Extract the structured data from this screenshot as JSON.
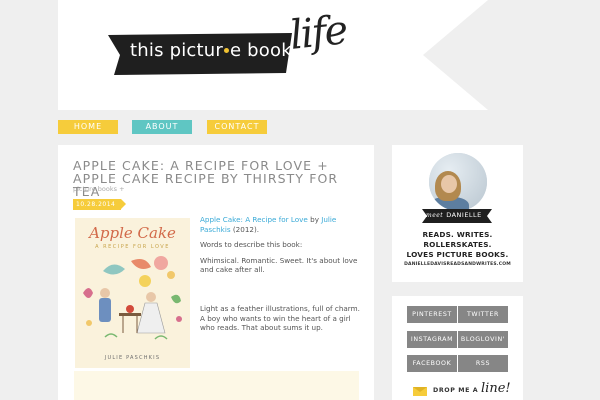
{
  "header": {
    "logo_text_1": "this pictur",
    "logo_text_2": "e book",
    "logo_script": "life"
  },
  "nav": {
    "home": "HOME",
    "about": "ABOUT",
    "contact": "CONTACT"
  },
  "post": {
    "title": "APPLE CAKE: A RECIPE FOR LOVE + APPLE CAKE RECIPE BY THIRSTY FOR TEA",
    "category": "picture books +",
    "date": "10.28.2014",
    "book": {
      "title": "Apple Cake",
      "subtitle": "A RECIPE FOR LOVE",
      "author": "JULIE PASCHKIS"
    },
    "body": {
      "link1": "Apple Cake: A Recipe for Love",
      "by": " by ",
      "link2": "Julie Paschkis",
      "year": " (2012).",
      "p2": "Words to describe this book:",
      "p3": "Whimsical. Romantic. Sweet. It's about love and cake after all.",
      "p4": "Light as a feather illustrations, full of charm. A boy who wants to win the heart of a  girl who reads. That about sums it up."
    }
  },
  "sidebar": {
    "meet_prefix": "meet",
    "meet_name": "DANIELLE",
    "tagline_1": "READS. WRITES.",
    "tagline_2": "ROLLERSKATES.",
    "tagline_3": "LOVES PICTURE BOOKS.",
    "site": "DANIELLEDAVISREADSANDWRITES.COM",
    "social": {
      "pinterest": "PINTEREST",
      "twitter": "TWITTER",
      "instagram": "INSTAGRAM",
      "bloglovin": "BLOGLOVIN'",
      "facebook": "FACEBOOK",
      "rss": "RSS"
    },
    "drop_text": "DROP ME A",
    "drop_script": "line!"
  },
  "colors": {
    "yellow": "#f6cc3b",
    "teal": "#5fc6c3",
    "link": "#3aaad7",
    "social_gray": "#868686"
  }
}
